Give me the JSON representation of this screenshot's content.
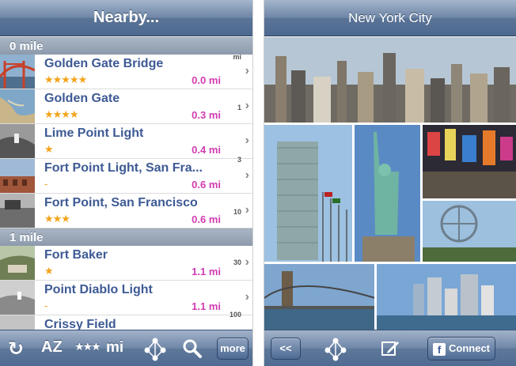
{
  "left": {
    "title": "Nearby...",
    "sections": [
      {
        "label": "0 mile",
        "rows": [
          {
            "title": "Golden Gate Bridge",
            "stars": "★★★★★",
            "distance": "0.0 mi"
          },
          {
            "title": "Golden Gate",
            "stars": "★★★★",
            "distance": "0.3 mi"
          },
          {
            "title": "Lime Point Light",
            "stars": "★",
            "distance": "0.4 mi"
          },
          {
            "title": "Fort Point Light, San Fra...",
            "stars": "-",
            "distance": "0.6 mi"
          },
          {
            "title": "Fort Point, San Francisco",
            "stars": "★★★",
            "distance": "0.6 mi"
          }
        ]
      },
      {
        "label": "1 mile",
        "rows": [
          {
            "title": "Fort Baker",
            "stars": "★",
            "distance": "1.1 mi"
          },
          {
            "title": "Point Diablo Light",
            "stars": "-",
            "distance": "1.1 mi"
          },
          {
            "title": "Crissy Field",
            "stars": "",
            "distance": ""
          }
        ]
      }
    ],
    "index": [
      "mi",
      "1",
      "3",
      "10",
      "30",
      "100"
    ],
    "toolbar": {
      "refresh_icon": "refresh-icon",
      "sort_az": "AZ",
      "sort_stars": "★★★",
      "sort_mi": "mi",
      "more": "more"
    }
  },
  "right": {
    "title": "New York City",
    "toolbar": {
      "back": "<<",
      "connect": "Connect"
    }
  },
  "colors": {
    "title_blue": "#3d5a94",
    "distance_magenta": "#d23cb2",
    "star_orange": "#f3a31a",
    "bar_blue": "#5b7497"
  }
}
